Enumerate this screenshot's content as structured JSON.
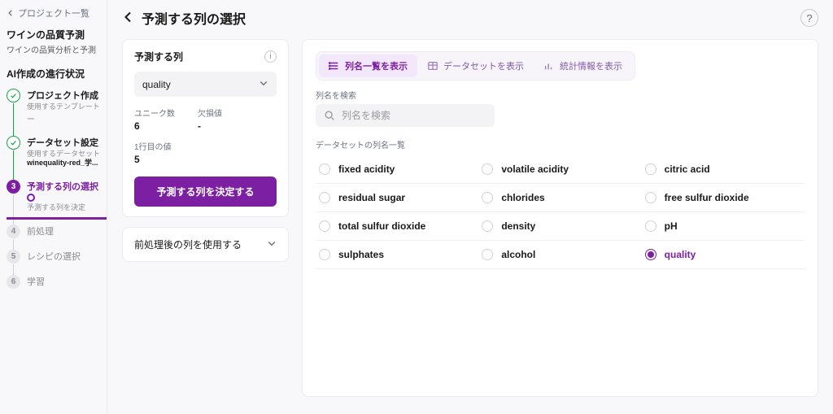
{
  "sidebar": {
    "back_label": "プロジェクト一覧",
    "project_title": "ワインの品質予測",
    "project_sub": "ワインの品質分析と予測",
    "progress_title": "AI作成の進行状況",
    "steps": [
      {
        "label": "プロジェクト作成",
        "sub_label": "使用するテンプレート",
        "sub_value": "ー",
        "state": "done"
      },
      {
        "label": "データセット設定",
        "sub_label": "使用するデータセット",
        "sub_value": "winequality-red_学...",
        "state": "done"
      },
      {
        "label": "予測する列の選択",
        "sub_label": "予測する列を決定",
        "state": "current"
      },
      {
        "num": "4",
        "label": "前処理",
        "state": "pending"
      },
      {
        "num": "5",
        "label": "レシピの選択",
        "state": "pending"
      },
      {
        "num": "6",
        "label": "学習",
        "state": "pending"
      }
    ]
  },
  "header": {
    "title": "予測する列の選択"
  },
  "config": {
    "card_title": "予測する列",
    "selected_column": "quality",
    "unique_label": "ユニーク数",
    "unique_value": "6",
    "missing_label": "欠損値",
    "missing_value": "-",
    "first_row_label": "1行目の値",
    "first_row_value": "5",
    "confirm_button": "予測する列を決定する",
    "postprocess_toggle": "前処理後の列を使用する"
  },
  "right": {
    "tabs": [
      {
        "label": "列名一覧を表示",
        "active": true
      },
      {
        "label": "データセットを表示",
        "active": false
      },
      {
        "label": "統計情報を表示",
        "active": false
      }
    ],
    "search_label": "列名を検索",
    "search_placeholder": "列名を検索",
    "list_label": "データセットの列名一覧",
    "columns": [
      {
        "name": "fixed acidity",
        "selected": false
      },
      {
        "name": "volatile acidity",
        "selected": false
      },
      {
        "name": "citric acid",
        "selected": false
      },
      {
        "name": "residual sugar",
        "selected": false
      },
      {
        "name": "chlorides",
        "selected": false
      },
      {
        "name": "free sulfur dioxide",
        "selected": false
      },
      {
        "name": "total sulfur dioxide",
        "selected": false
      },
      {
        "name": "density",
        "selected": false
      },
      {
        "name": "pH",
        "selected": false
      },
      {
        "name": "sulphates",
        "selected": false
      },
      {
        "name": "alcohol",
        "selected": false
      },
      {
        "name": "quality",
        "selected": true
      }
    ]
  }
}
